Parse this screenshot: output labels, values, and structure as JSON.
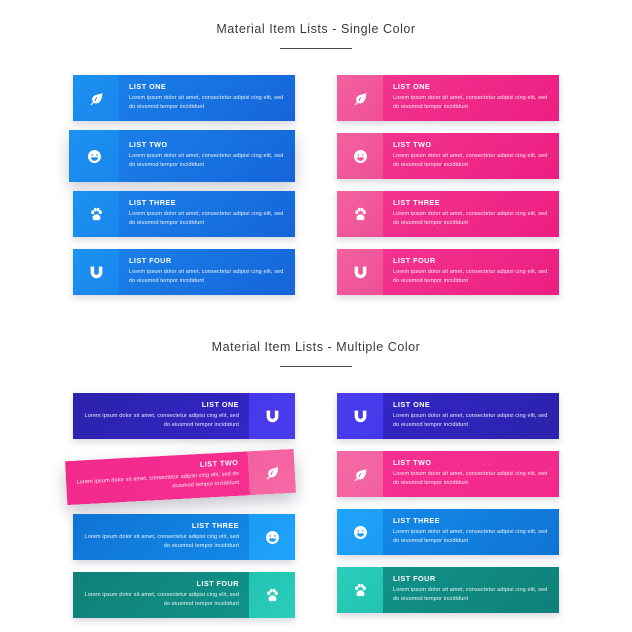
{
  "page": {
    "background": "#ffffff"
  },
  "sections": [
    {
      "id": "single-color",
      "title": "Material Item Lists - Single Color",
      "columns": [
        {
          "id": "blue-column",
          "icon_side": "left",
          "items": [
            {
              "title": "LIST ONE",
              "desc": "Lorem ipsum dolor sit amet, consectetur adipisi cing elit, sed do eiusmod tempor incididunt",
              "icon": "leaf-icon",
              "body_from": "#1a7fe8",
              "body_to": "#1565d8",
              "icon_bg_from": "#1b92f0",
              "icon_bg_to": "#1a85ec",
              "state": "normal"
            },
            {
              "title": "LIST TWO",
              "desc": "Lorem ipsum dolor sit amet, consectetur adipisi cing elit, sed do eiusmod tempor incididunt",
              "icon": "smiley-icon",
              "body_from": "#1a7fe8",
              "body_to": "#1565d8",
              "icon_bg_from": "#1b92f0",
              "icon_bg_to": "#1a85ec",
              "state": "elevated"
            },
            {
              "title": "LIST THREE",
              "desc": "Lorem ipsum dolor sit amet, consectetur adipisi cing elit, sed do eiusmod tempor incididunt",
              "icon": "paw-icon",
              "body_from": "#1a7fe8",
              "body_to": "#1565d8",
              "icon_bg_from": "#1b92f0",
              "icon_bg_to": "#1a85ec",
              "state": "normal"
            },
            {
              "title": "LIST FOUR",
              "desc": "Lorem ipsum dolor sit amet, consectetur adipisi cing elit, sed do eiusmod tempor incididunt",
              "icon": "magnet-icon",
              "body_from": "#1a7fe8",
              "body_to": "#1565d8",
              "icon_bg_from": "#1b92f0",
              "icon_bg_to": "#1a85ec",
              "state": "normal"
            }
          ]
        },
        {
          "id": "pink-column",
          "icon_side": "left",
          "items": [
            {
              "title": "LIST ONE",
              "desc": "Lorem ipsum dolor sit amet, consectetur adipisi cing elit, sed do eiusmod tempor incididunt",
              "icon": "leaf-icon",
              "body_from": "#f2338f",
              "body_to": "#ec1e82",
              "icon_bg_from": "#f2629f",
              "icon_bg_to": "#ef4e96",
              "state": "normal"
            },
            {
              "title": "LIST TWO",
              "desc": "Lorem ipsum dolor sit amet, consectetur adipisi cing elit, sed do eiusmod tempor incididunt",
              "icon": "smiley-icon",
              "body_from": "#f2338f",
              "body_to": "#ec1e82",
              "icon_bg_from": "#f2629f",
              "icon_bg_to": "#ef4e96",
              "state": "normal"
            },
            {
              "title": "LIST THREE",
              "desc": "Lorem ipsum dolor sit amet, consectetur adipisi cing elit, sed do eiusmod tempor incididunt",
              "icon": "paw-icon",
              "body_from": "#f2338f",
              "body_to": "#ec1e82",
              "icon_bg_from": "#f2629f",
              "icon_bg_to": "#ef4e96",
              "state": "normal"
            },
            {
              "title": "LIST FOUR",
              "desc": "Lorem ipsum dolor sit amet, consectetur adipisi cing elit, sed do eiusmod tempor incididunt",
              "icon": "magnet-icon",
              "body_from": "#f2338f",
              "body_to": "#ec1e82",
              "icon_bg_from": "#f2629f",
              "icon_bg_to": "#ef4e96",
              "state": "normal"
            }
          ]
        }
      ]
    },
    {
      "id": "multiple-color",
      "title": "Material Item Lists - Multiple Color",
      "columns": [
        {
          "id": "multi-left-column",
          "icon_side": "right",
          "items": [
            {
              "title": "LIST ONE",
              "desc": "Lorem ipsum dolor sit amet, consectetur adipisi cing elit, sed do eiusmod tempor incididunt",
              "icon": "magnet-icon",
              "body_from": "#2b22ab",
              "body_to": "#3326c6",
              "icon_bg_from": "#4538e8",
              "icon_bg_to": "#4a3df0",
              "state": "normal"
            },
            {
              "title": "LIST TWO",
              "desc": "Lorem ipsum dolor sit amet, consectetur adipisi cing elit, sed do eiusmod tempor incididunt",
              "icon": "leaf-icon",
              "body_from": "#f4288c",
              "body_to": "#f52f90",
              "icon_bg_from": "#f4609f",
              "icon_bg_to": "#f56aa6",
              "state": "tilted"
            },
            {
              "title": "LIST THREE",
              "desc": "Lorem ipsum dolor sit amet, consectetur adipisi cing elit, sed do eiusmod tempor incididunt",
              "icon": "smiley-icon",
              "body_from": "#0f74d4",
              "body_to": "#1389e8",
              "icon_bg_from": "#1b9bf4",
              "icon_bg_to": "#1fa4f8",
              "state": "normal"
            },
            {
              "title": "LIST FOUR",
              "desc": "Lorem ipsum dolor sit amet, consectetur adipisi cing elit, sed do eiusmod tempor incididunt",
              "icon": "paw-icon",
              "body_from": "#0e8079",
              "body_to": "#119289",
              "icon_bg_from": "#23c3b2",
              "icon_bg_to": "#2acdbb",
              "state": "normal"
            }
          ]
        },
        {
          "id": "multi-right-column",
          "icon_side": "left",
          "items": [
            {
              "title": "LIST ONE",
              "desc": "Lorem ipsum dolor sit amet, consectetur adipisi cing elit, sed do eiusmod tempor incididunt",
              "icon": "magnet-icon",
              "body_from": "#3326c6",
              "body_to": "#2b22ab",
              "icon_bg_from": "#4a3df0",
              "icon_bg_to": "#4538e8",
              "state": "normal"
            },
            {
              "title": "LIST TWO",
              "desc": "Lorem ipsum dolor sit amet, consectetur adipisi cing elit, sed do eiusmod tempor incididunt",
              "icon": "leaf-icon",
              "body_from": "#f52f90",
              "body_to": "#f4288c",
              "icon_bg_from": "#f56aa6",
              "icon_bg_to": "#f4609f",
              "state": "normal"
            },
            {
              "title": "LIST THREE",
              "desc": "Lorem ipsum dolor sit amet, consectetur adipisi cing elit, sed do eiusmod tempor incididunt",
              "icon": "smiley-icon",
              "body_from": "#1389e8",
              "body_to": "#0f74d4",
              "icon_bg_from": "#1fa4f8",
              "icon_bg_to": "#1b9bf4",
              "state": "normal"
            },
            {
              "title": "LIST FOUR",
              "desc": "Lorem ipsum dolor sit amet, consectetur adipisi cing elit, sed do eiusmod tempor incididunt",
              "icon": "paw-icon",
              "body_from": "#119289",
              "body_to": "#0e8079",
              "icon_bg_from": "#2acdbb",
              "icon_bg_to": "#23c3b2",
              "state": "normal"
            }
          ]
        }
      ]
    }
  ]
}
